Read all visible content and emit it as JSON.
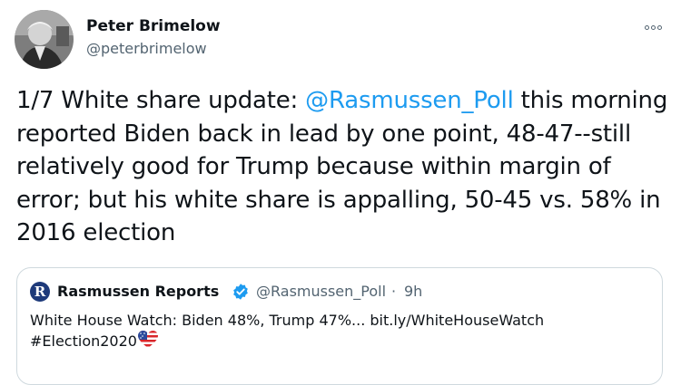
{
  "author": {
    "name": "Peter Brimelow",
    "handle": "@peterbrimelow"
  },
  "more_icon": "more-horizontal-icon",
  "tweet": {
    "text_before": "1/7 White share update: ",
    "mention": "@Rasmussen_Poll",
    "text_after": " this morning reported Biden back in lead by one point, 48-47--still relatively good for Trump because within margin of error; but his white share is appalling, 50-45 vs. 58% in 2016 election"
  },
  "quote": {
    "name": "Rasmussen Reports",
    "verified_icon": "verified-badge-icon",
    "handle": "@Rasmussen_Poll",
    "separator": "·",
    "time": "9h",
    "text_line1": "White House Watch: Biden 48%, Trump 47%... bit.ly/WhiteHouseWatch",
    "text_line2": "#Election2020",
    "emoji": "us-flag-heart-emoji",
    "avatar_letter": "R",
    "brand_color": "#1e3a7a"
  },
  "colors": {
    "link": "#1d9bf0",
    "text": "#0f1419",
    "secondary": "#536471",
    "verified": "#1d9bf0"
  }
}
